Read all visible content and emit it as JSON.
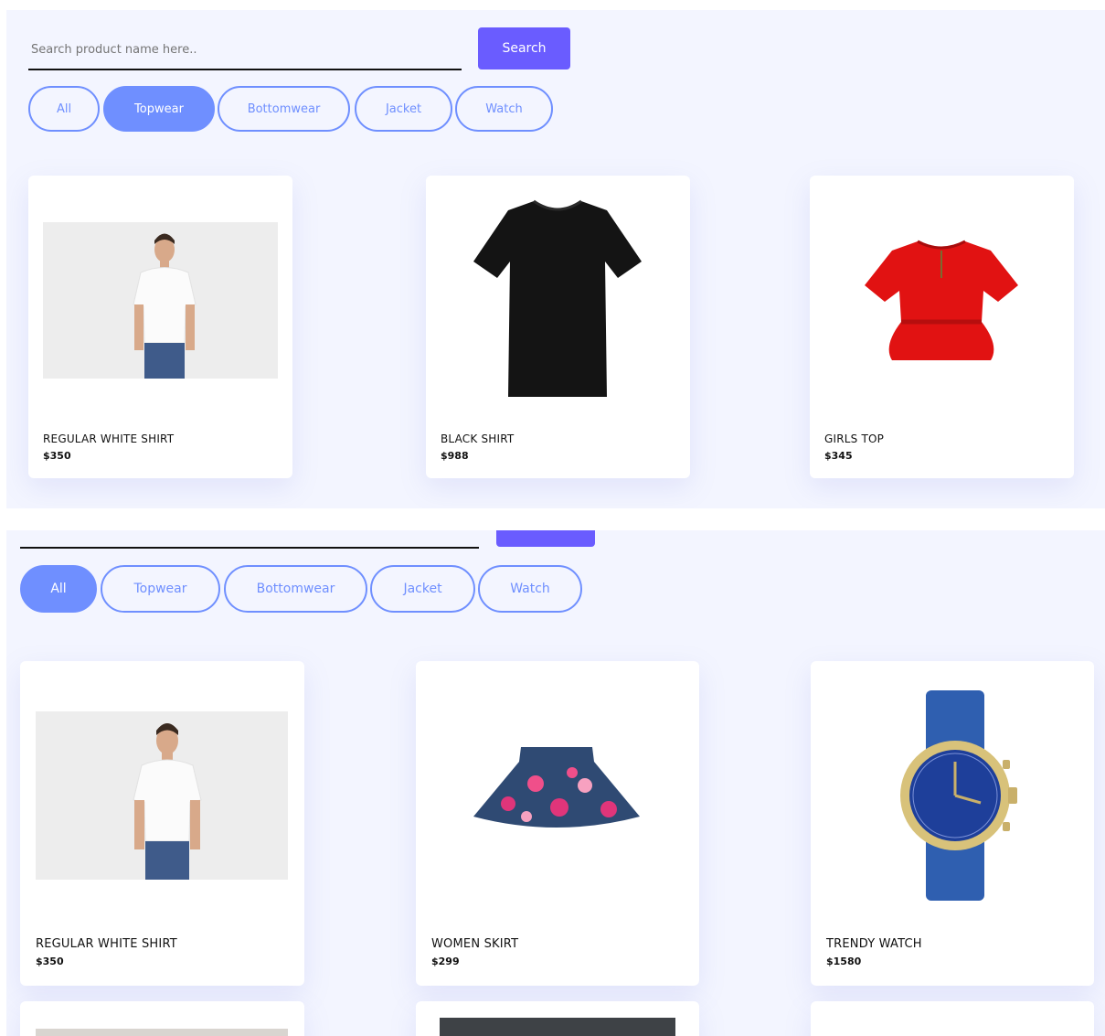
{
  "top": {
    "search": {
      "placeholder": "Search product name here..",
      "value": ""
    },
    "search_button": "Search",
    "filters": [
      {
        "label": "All",
        "active": false
      },
      {
        "label": "Topwear",
        "active": true
      },
      {
        "label": "Bottomwear",
        "active": false
      },
      {
        "label": "Jacket",
        "active": false
      },
      {
        "label": "Watch",
        "active": false
      }
    ],
    "products": [
      {
        "name": "REGULAR WHITE SHIRT",
        "price": "$350"
      },
      {
        "name": "BLACK SHIRT",
        "price": "$988"
      },
      {
        "name": "GIRLS TOP",
        "price": "$345"
      }
    ]
  },
  "bottom": {
    "filters": [
      {
        "label": "All",
        "active": true
      },
      {
        "label": "Topwear",
        "active": false
      },
      {
        "label": "Bottomwear",
        "active": false
      },
      {
        "label": "Jacket",
        "active": false
      },
      {
        "label": "Watch",
        "active": false
      }
    ],
    "products": [
      {
        "name": "REGULAR WHITE SHIRT",
        "price": "$350"
      },
      {
        "name": "WOMEN SKIRT",
        "price": "$299"
      },
      {
        "name": "TRENDY WATCH",
        "price": "$1580"
      }
    ]
  },
  "colors": {
    "accent": "#6a5cff",
    "chip": "#6f8fff",
    "background": "#f3f5ff"
  }
}
